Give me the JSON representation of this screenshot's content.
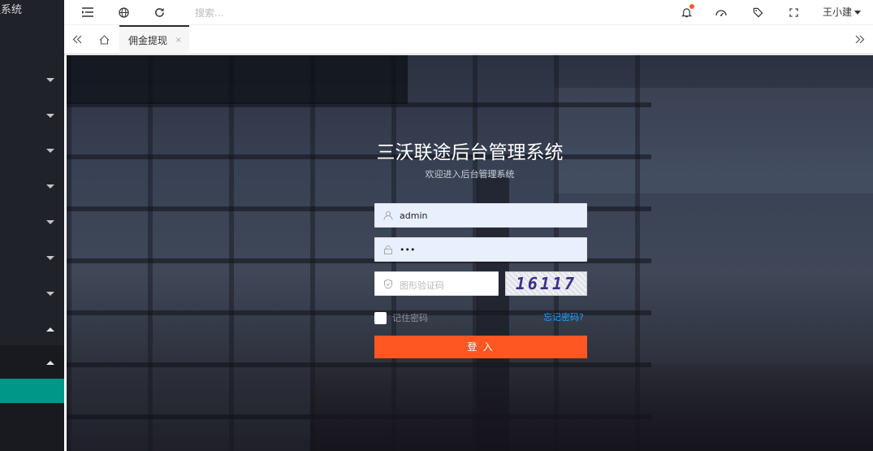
{
  "sidebar": {
    "title": "理系统",
    "menu": [
      {
        "state": "collapsed"
      },
      {
        "state": "collapsed"
      },
      {
        "state": "collapsed"
      },
      {
        "state": "collapsed"
      },
      {
        "state": "collapsed"
      },
      {
        "state": "collapsed"
      },
      {
        "state": "collapsed"
      },
      {
        "state": "expanded"
      },
      {
        "state": "expanded"
      }
    ],
    "active_color": "#009688"
  },
  "header": {
    "icons": [
      "menu-collapse-icon",
      "globe-icon",
      "refresh-icon"
    ],
    "search_placeholder": "搜索...",
    "right_icons": [
      "notification-bell-icon",
      "theme-palette-icon",
      "tag-icon",
      "fullscreen-icon"
    ],
    "user_name": "王小建"
  },
  "tabs": {
    "active_label": "佣金提现",
    "close_label": "×"
  },
  "login": {
    "title": "三沃联途后台管理系统",
    "subtitle": "欢迎进入后台管理系统",
    "username_value": "admin",
    "password_value": "•••",
    "captcha_placeholder": "图形验证码",
    "captcha_text": "16117",
    "remember_label": "记住密码",
    "forgot_label": "忘记密码?",
    "login_button": "登 入",
    "button_color": "#ff5722",
    "field_fill_color": "#e8f0fe"
  }
}
